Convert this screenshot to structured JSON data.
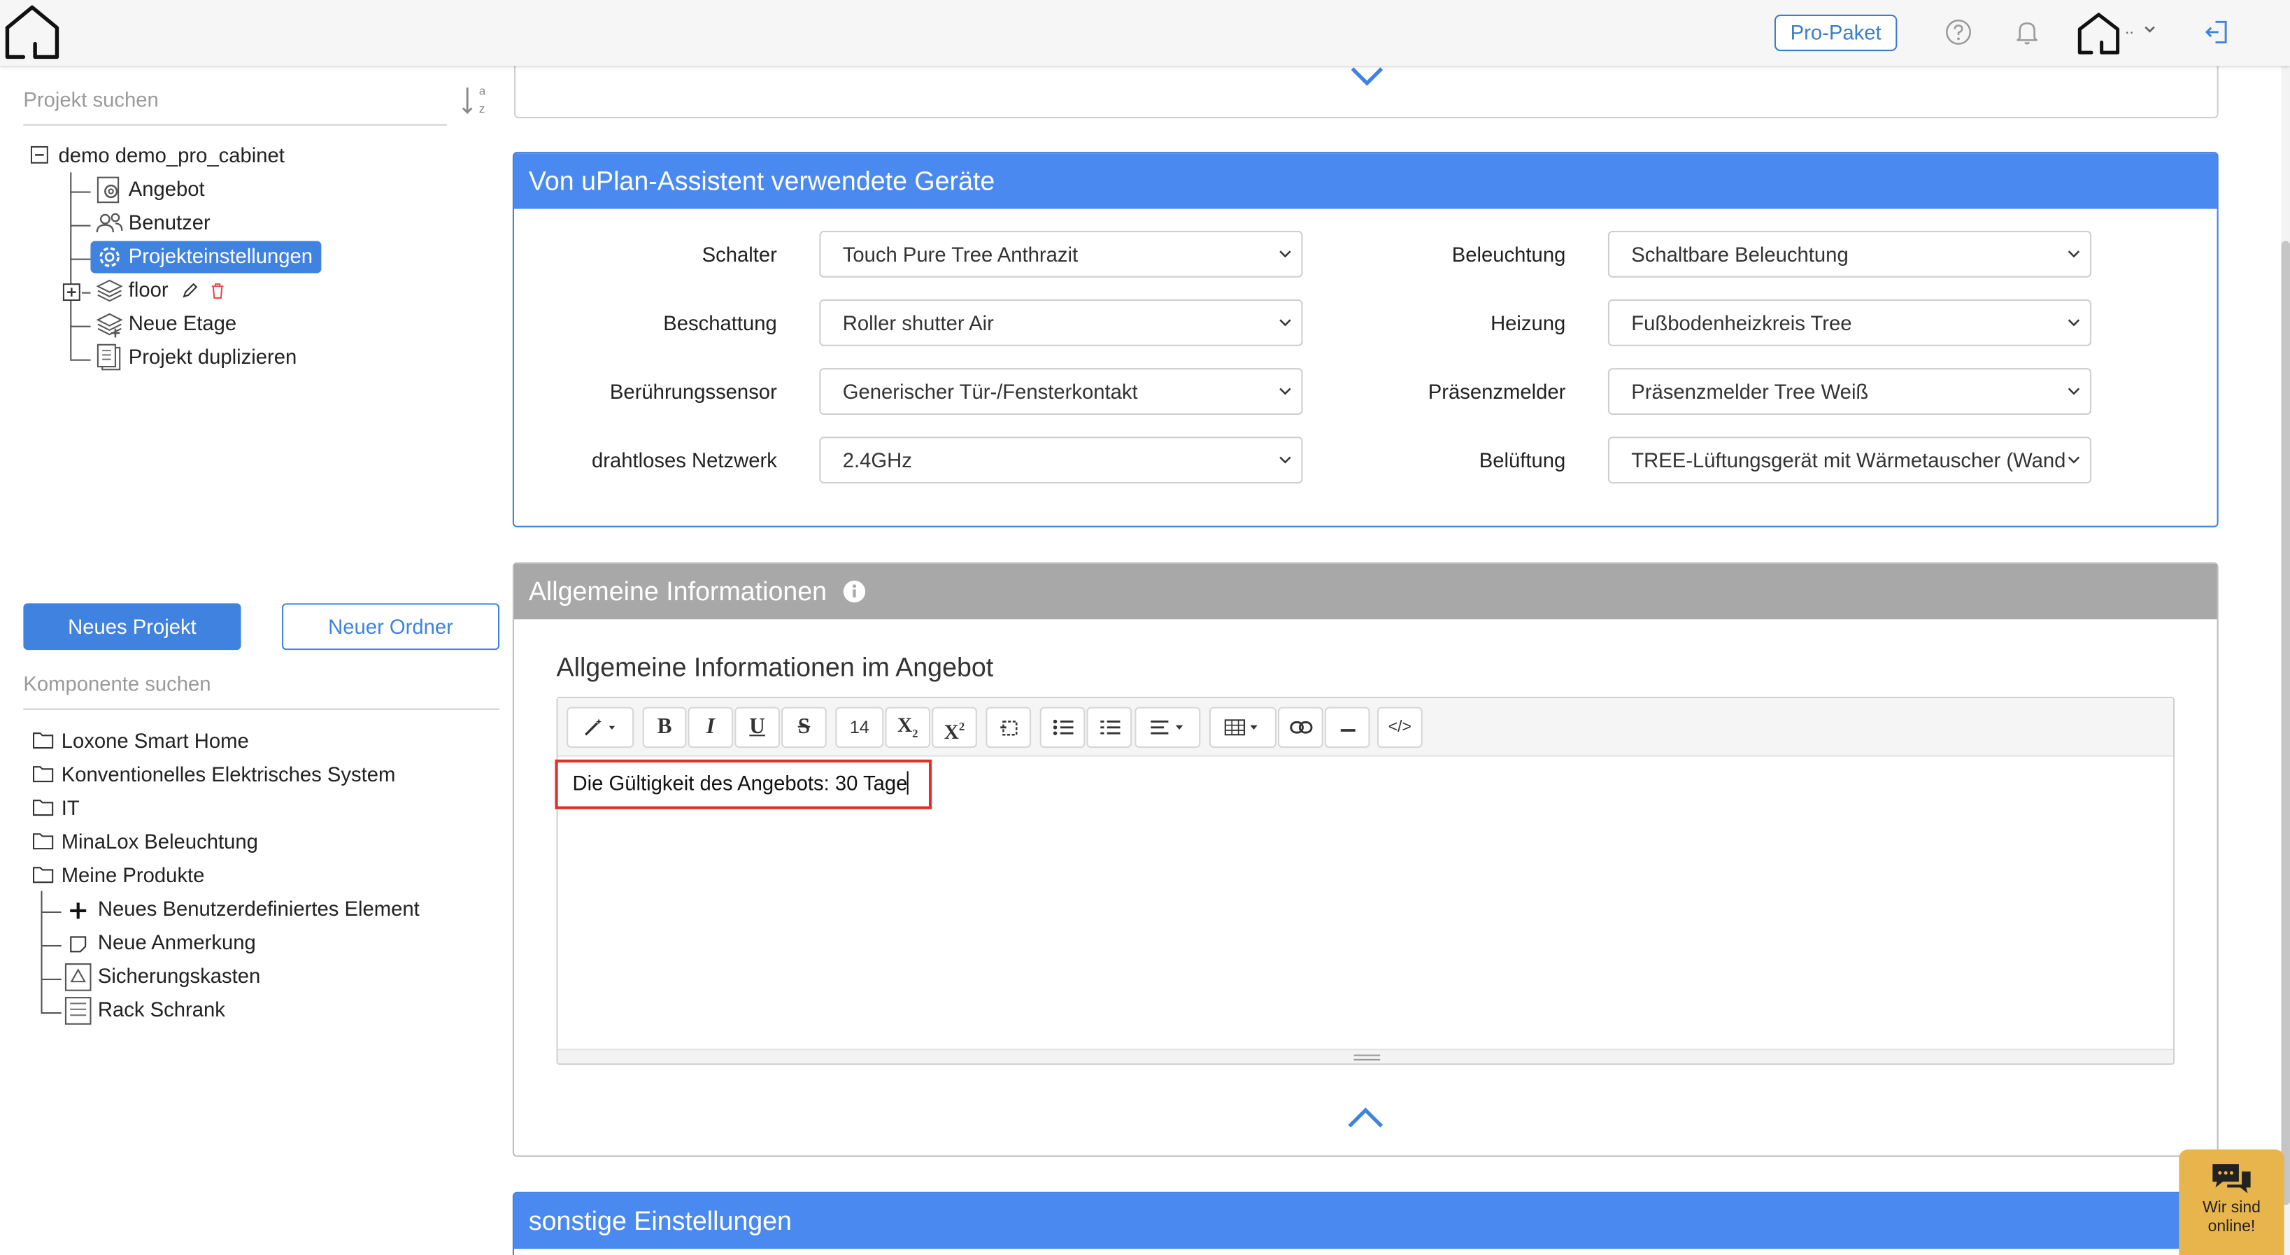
{
  "topbar": {
    "pro_package_label": "Pro-Paket",
    "user_dots": "..",
    "icons": [
      "house-logo-icon",
      "help-icon",
      "bell-icon",
      "user-house-icon",
      "chevron-down-icon",
      "logout-icon"
    ]
  },
  "sidebar": {
    "project_search_placeholder": "Projekt suchen",
    "sort_letters_top": "a",
    "sort_letters_bottom": "z",
    "project_tree": {
      "root_label": "demo demo_pro_cabinet",
      "items": [
        {
          "label": "Angebot",
          "icon": "gear-document-icon"
        },
        {
          "label": "Benutzer",
          "icon": "users-icon"
        },
        {
          "label": "Projekteinstellungen",
          "icon": "gear-icon",
          "selected": true
        },
        {
          "label": "floor",
          "icon": "layers-icon"
        },
        {
          "label": "Neue Etage",
          "icon": "add-layer-icon"
        },
        {
          "label": "Projekt duplizieren",
          "icon": "duplicate-icon"
        }
      ]
    },
    "new_project_label": "Neues Projekt",
    "new_folder_label": "Neuer Ordner",
    "component_search_placeholder": "Komponente suchen",
    "component_tree": {
      "folders": [
        "Loxone Smart Home",
        "Konventionelles Elektrisches System",
        "IT",
        "MinaLox Beleuchtung",
        "Meine Produkte"
      ],
      "my_products": [
        {
          "label": "Neues Benutzerdefiniertes Element",
          "icon": "plus-icon"
        },
        {
          "label": "Neue Anmerkung",
          "icon": "note-icon"
        },
        {
          "label": "Sicherungskasten",
          "icon": "fusebox-icon"
        },
        {
          "label": "Rack Schrank",
          "icon": "rack-icon"
        }
      ]
    }
  },
  "devices_panel": {
    "title": "Von uPlan-Assistent verwendete Geräte",
    "left_fields": [
      {
        "label": "Schalter",
        "value": "Touch Pure Tree Anthrazit"
      },
      {
        "label": "Beschattung",
        "value": "Roller shutter Air"
      },
      {
        "label": "Berührungssensor",
        "value": "Generischer Tür-/Fensterkontakt"
      },
      {
        "label": "drahtloses Netzwerk",
        "value": "2.4GHz"
      }
    ],
    "right_fields": [
      {
        "label": "Beleuchtung",
        "value": "Schaltbare Beleuchtung"
      },
      {
        "label": "Heizung",
        "value": "Fußbodenheizkreis Tree"
      },
      {
        "label": "Präsenzmelder",
        "value": "Präsenzmelder Tree Weiß"
      },
      {
        "label": "Belüftung",
        "value": "TREE-Lüftungsgerät mit Wärmetauscher (Wand"
      }
    ]
  },
  "general_panel": {
    "title": "Allgemeine Informationen",
    "subtitle": "Allgemeine Informationen im Angebot",
    "toolbar": {
      "font_size": "14",
      "buttons": [
        "magic-wand",
        "bold",
        "italic",
        "underline",
        "strikethrough",
        "font-size",
        "subscript",
        "superscript",
        "eraser",
        "bullet-list",
        "numbered-list",
        "align",
        "table",
        "link",
        "horizontal-rule",
        "code-view"
      ]
    },
    "editor_text": "Die Gültigkeit des Angebots: 30 Tage"
  },
  "other_panel": {
    "title": "sonstige Einstellungen"
  },
  "chat": {
    "line1": "Wir sind",
    "line2": "online!"
  }
}
